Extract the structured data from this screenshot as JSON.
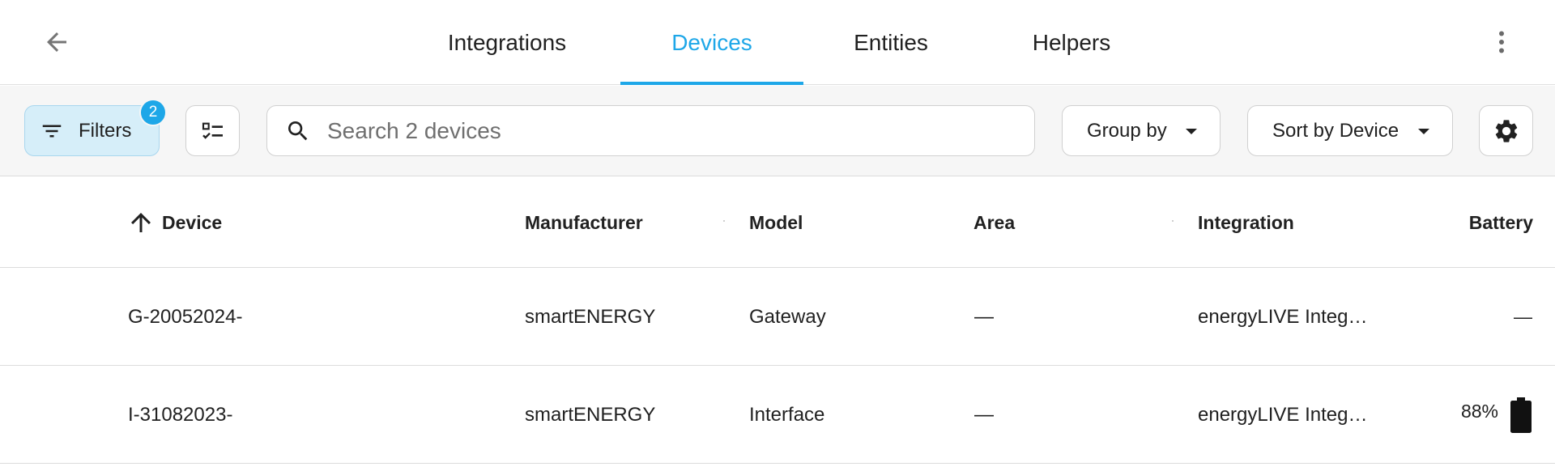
{
  "tabs": [
    {
      "label": "Integrations",
      "active": false
    },
    {
      "label": "Devices",
      "active": true
    },
    {
      "label": "Entities",
      "active": false
    },
    {
      "label": "Helpers",
      "active": false
    }
  ],
  "toolbar": {
    "filters_label": "Filters",
    "filters_count": "2",
    "search_placeholder": "Search 2 devices",
    "group_by_label": "Group by",
    "sort_label": "Sort by Device"
  },
  "table": {
    "columns": [
      "Device",
      "Manufacturer",
      "Model",
      "Area",
      "Integration",
      "Battery"
    ],
    "rows": [
      {
        "device": "G-20052024-",
        "manufacturer": "smartENERGY",
        "model": "Gateway",
        "area": "—",
        "integration": "energyLIVE Integ…",
        "battery": "—"
      },
      {
        "device": "I-31082023-",
        "manufacturer": "smartENERGY",
        "model": "Interface",
        "area": "—",
        "integration": "energyLIVE Integ…",
        "battery": "88%"
      }
    ]
  },
  "icons": {
    "back": "arrow-left-icon",
    "more": "dots-vertical-icon",
    "filter": "filter-icon",
    "select": "checklist-icon",
    "search": "magnify-icon",
    "settings": "cog-icon",
    "sort": "arrow-up-icon",
    "battery": "battery-icon"
  },
  "colors": {
    "accent": "#1ea7e8",
    "filters_bg": "#d6eef9",
    "toolbar_bg": "#f6f6f6"
  }
}
